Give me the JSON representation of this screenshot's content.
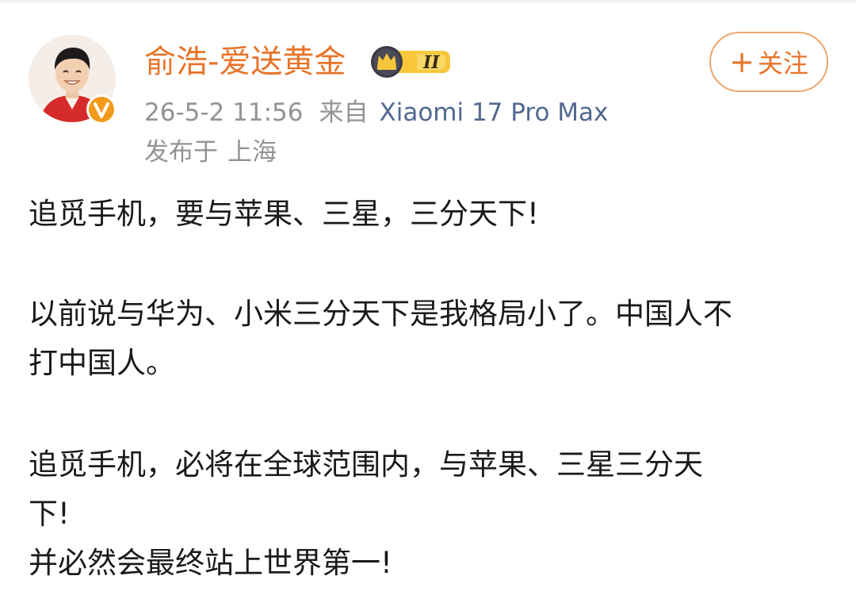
{
  "post": {
    "author": {
      "name": "俞浩-爱送黄金",
      "level_badge": "II",
      "verified": true
    },
    "timestamp": "26-5-2 11:56",
    "source_prefix": "来自",
    "device": "Xiaomi 17 Pro Max",
    "location_prefix": "发布于",
    "location": "上海",
    "follow_label": "关注",
    "lines": [
      "追觅手机，要与苹果、三星，三分天下!",
      "以前说与华为、小米三分天下是我格局小了。中国人不",
      "打中国人。",
      "追觅手机，必将在全球范围内，与苹果、三星三分天",
      "下!",
      "并必然会最终站上世界第一!"
    ]
  },
  "colors": {
    "username": "#e8742a",
    "device_link": "#52688f",
    "meta_gray": "#939393",
    "body_text": "#1a1a1a",
    "follow_border": "#eea56a",
    "verified_badge": "#f29a1b"
  },
  "icons": {
    "verified": "verified-v-icon",
    "level": "crown-level-icon",
    "follow": "plus-icon"
  }
}
